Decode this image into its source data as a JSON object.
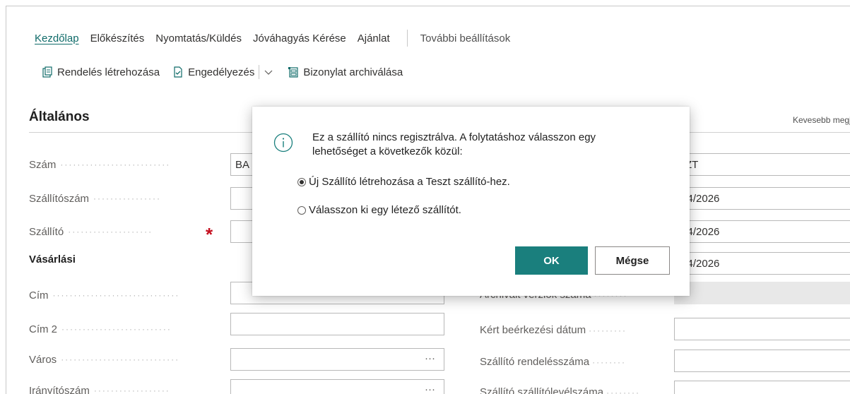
{
  "menu": {
    "items": [
      "Kezdőlap",
      "Előkészítés",
      "Nyomtatás/Küldés",
      "Jóváhagyás Kérése",
      "Ajánlat"
    ],
    "more": "További beállítások"
  },
  "actions": {
    "create_order": "Rendelés létrehozása",
    "approval": "Engedélyezés",
    "archive": "Bizonylat archiválása"
  },
  "section": {
    "title": "Általános",
    "less": "Kevesebb megje"
  },
  "left_fields": [
    {
      "label": "Szám",
      "value": "BA"
    },
    {
      "label": "Szállítószám",
      "value": ""
    },
    {
      "label": "Szállító",
      "value": ""
    },
    {
      "label": "Cím",
      "value": ""
    },
    {
      "label": "Cím 2",
      "value": ""
    },
    {
      "label": "Város",
      "value": ""
    },
    {
      "label": "Irányítószám",
      "value": ""
    }
  ],
  "subhead": "Vásárlási",
  "right_fields": [
    {
      "label": "",
      "value": "SZT"
    },
    {
      "label": "",
      "value": "/04/2026"
    },
    {
      "label": "",
      "value": "/04/2026"
    },
    {
      "label": "",
      "value": "/04/2026"
    },
    {
      "label": "Archivált verziók száma",
      "value": ""
    },
    {
      "label": "Kért beérkezési dátum",
      "value": ""
    },
    {
      "label": "Szállító rendelésszáma",
      "value": ""
    },
    {
      "label": "Szállító szállítólevélszáma",
      "value": ""
    }
  ],
  "dialog": {
    "message": "Ez a szállító nincs regisztrálva. A folytatáshoz válasszon egy lehetőséget a következők közül:",
    "option1": "Új Szállító létrehozása a Teszt szállító-hez.",
    "option2": "Válasszon ki egy létező szállítót.",
    "ok": "OK",
    "cancel": "Mégse"
  },
  "colors": {
    "accent": "#1a7f7d",
    "link": "#0f6b69",
    "required": "#c50f1f"
  }
}
